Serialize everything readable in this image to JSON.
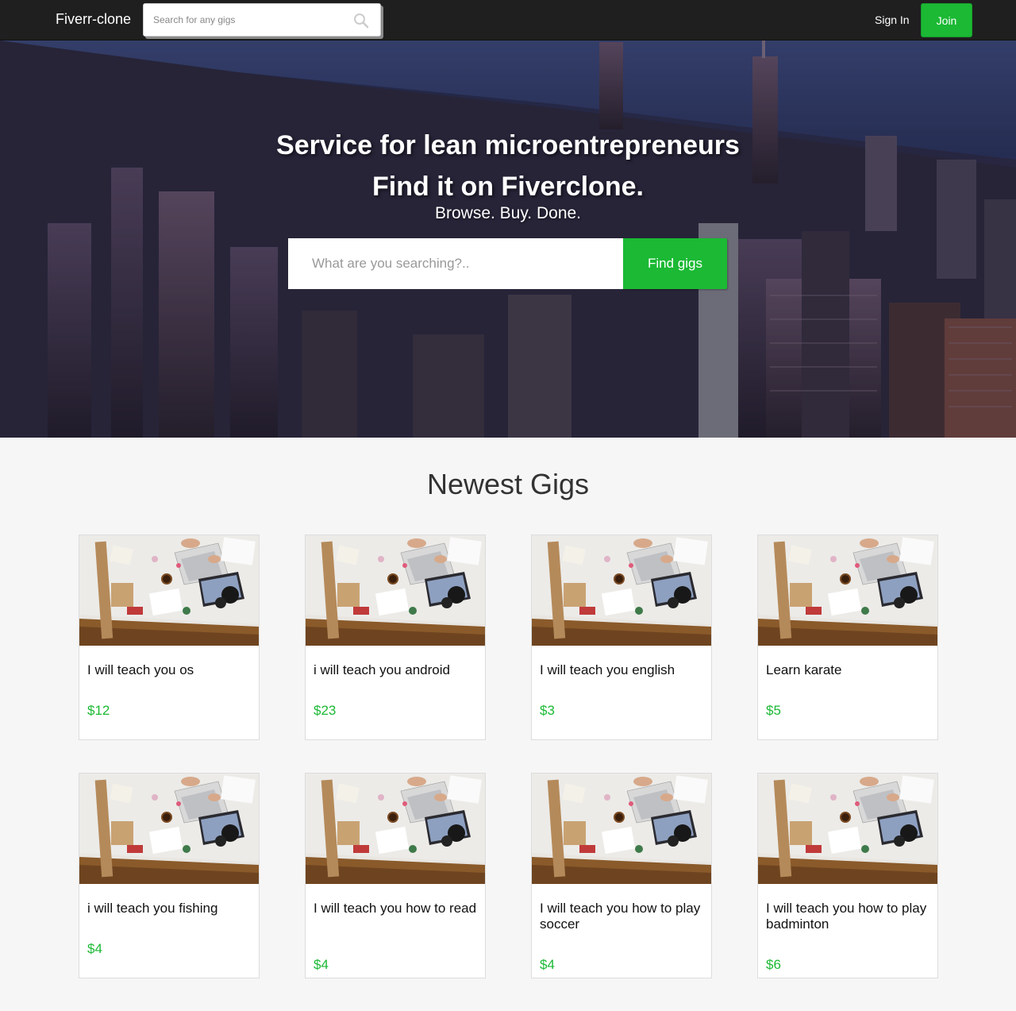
{
  "nav": {
    "brand": "Fiverr-clone",
    "search_placeholder": "Search for any gigs",
    "signin_label": "Sign In",
    "join_label": "Join"
  },
  "hero": {
    "title_line1": "Service for lean microentrepreneurs",
    "title_line2": "Find it on Fiverclone.",
    "subtitle": "Browse. Buy. Done.",
    "search_placeholder": "What are you searching?..",
    "button_label": "Find gigs"
  },
  "gigs": {
    "heading": "Newest Gigs",
    "items": [
      {
        "title": "I will teach you os",
        "price": "$12"
      },
      {
        "title": "i will teach you android",
        "price": "$23"
      },
      {
        "title": "I will teach you english",
        "price": "$3"
      },
      {
        "title": "Learn karate",
        "price": "$5"
      },
      {
        "title": "i will teach you fishing",
        "price": "$4"
      },
      {
        "title": "I will teach you how to read",
        "price": "$4"
      },
      {
        "title": "I will teach you how to play soccer",
        "price": "$4"
      },
      {
        "title": "I will teach you how to play badminton",
        "price": "$6"
      }
    ]
  },
  "colors": {
    "accent": "#1bb934",
    "navbar": "#1f1f1f",
    "page_bg": "#f6f6f6"
  }
}
